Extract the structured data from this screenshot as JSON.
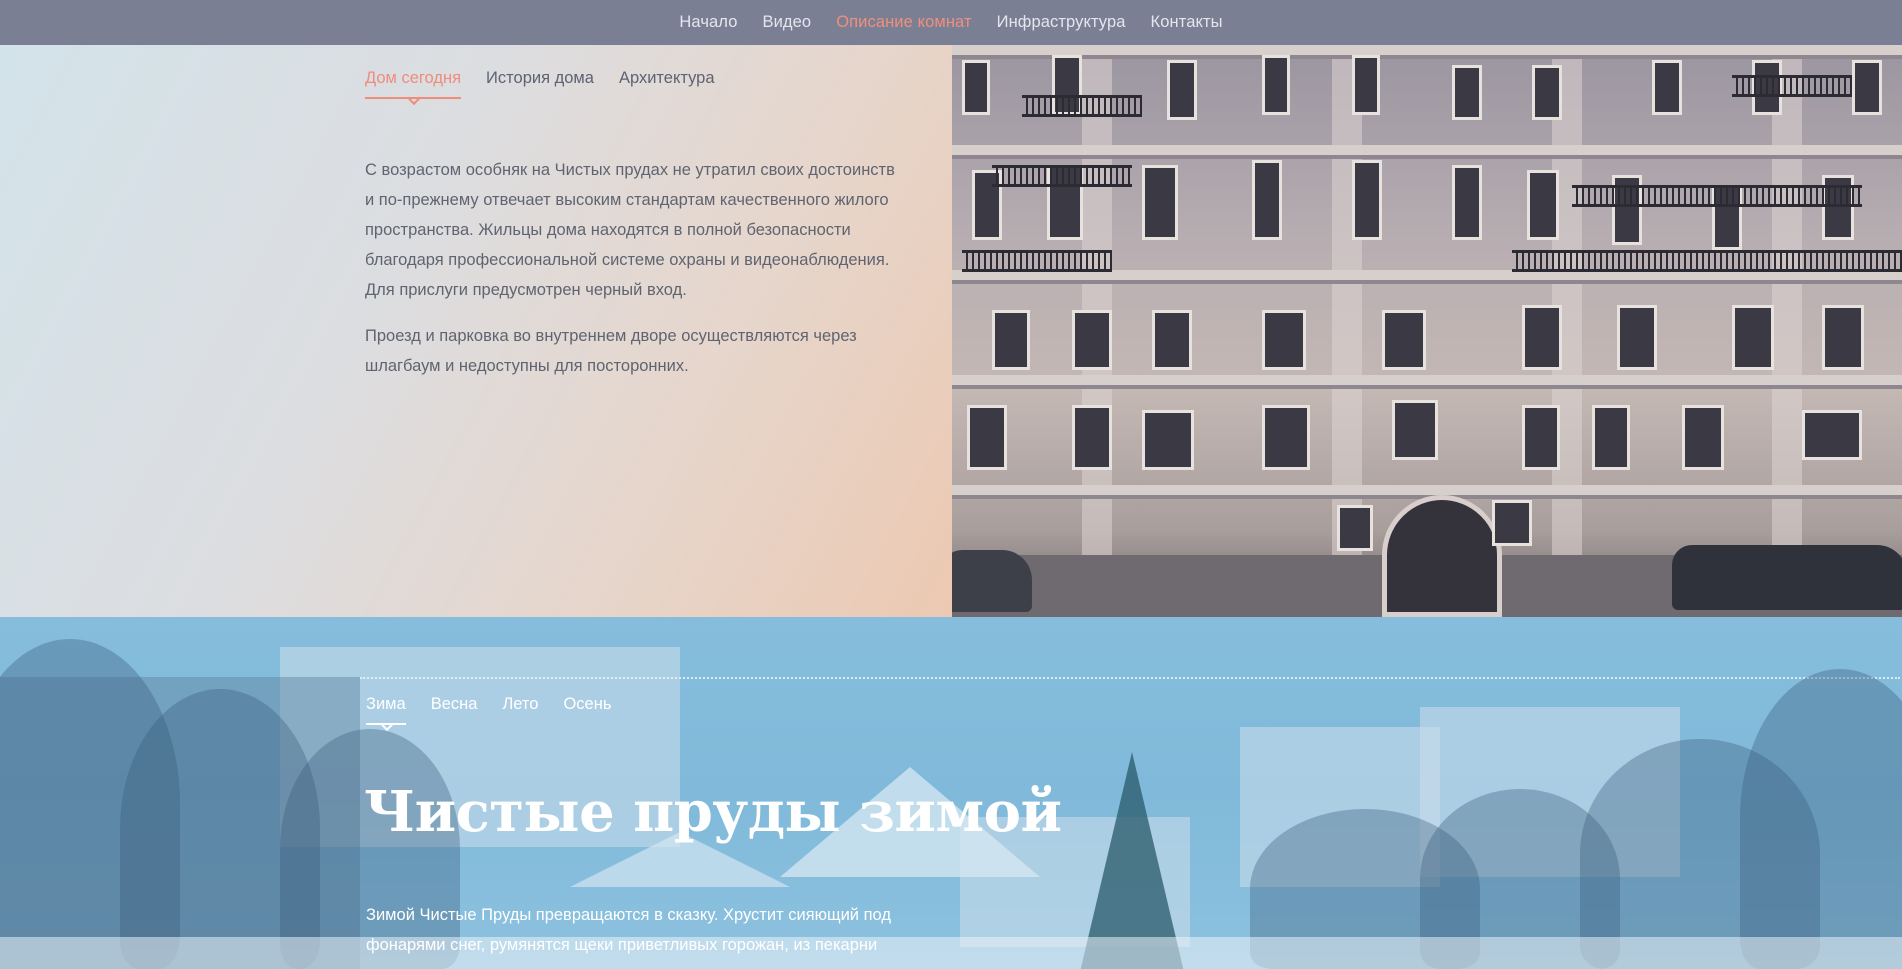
{
  "nav": {
    "items": [
      {
        "label": "Начало"
      },
      {
        "label": "Видео"
      },
      {
        "label": "Описание комнат"
      },
      {
        "label": "Инфраструктура"
      },
      {
        "label": "Контакты"
      }
    ],
    "active_index": 2,
    "active_color": "#f08f7d"
  },
  "house": {
    "tabs": [
      {
        "label": "Дом сегодня"
      },
      {
        "label": "История дома"
      },
      {
        "label": "Архитектура"
      }
    ],
    "active_tab": 0,
    "paragraphs": [
      "С возрастом особняк на Чистых прудах не утратил своих достоинств и по-прежнему отвечает высоким стандартам качественного жилого пространства. Жильцы дома находятся в полной безопасности благодаря профессиональной системе охраны и видеонаблюдения. Для прислуги предусмотрен черный вход.",
      "Проезд и парковка во внутреннем дворе осуществляются через шлагбаум и недоступны для посторонних."
    ]
  },
  "seasons": {
    "tabs": [
      {
        "label": "Зима"
      },
      {
        "label": "Весна"
      },
      {
        "label": "Лето"
      },
      {
        "label": "Осень"
      }
    ],
    "active_tab": 0,
    "title": "Чистые пруды зимой",
    "text": "Зимой Чистые Пруды превращаются в сказку. Хрустит сияющий под фонарями снег, румянятся щеки приветливых горожан, из пекарни"
  }
}
